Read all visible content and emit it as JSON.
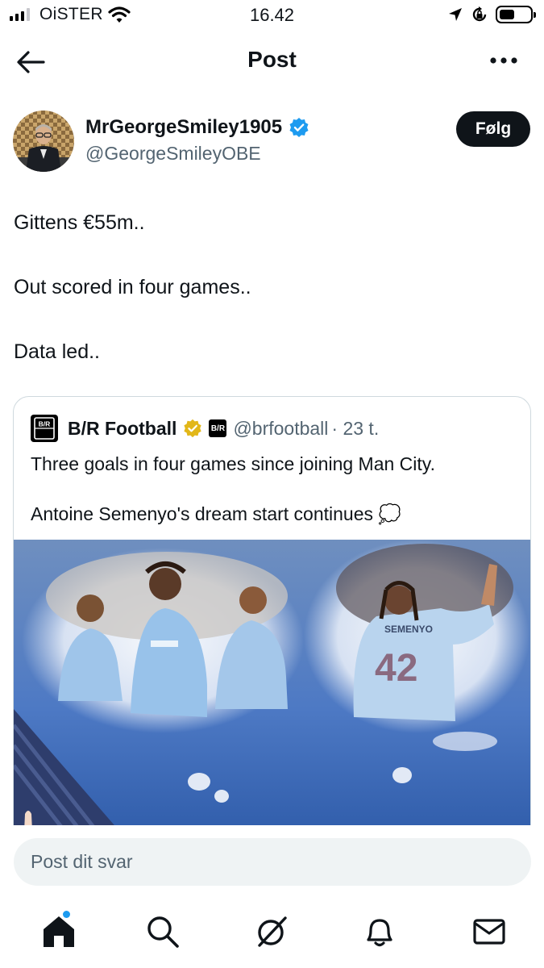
{
  "status_bar": {
    "carrier": "OiSTER",
    "time": "16.42",
    "icons": [
      "signal-icon",
      "wifi-icon",
      "location-arrow-icon",
      "rotation-lock-icon",
      "battery-icon"
    ]
  },
  "header": {
    "title": "Post",
    "back_icon": "arrow-left-icon",
    "more_icon": "more-dots-icon"
  },
  "author": {
    "name": "MrGeorgeSmiley1905",
    "handle": "@GeorgeSmileyOBE",
    "verified": true,
    "follow_label": "Følg"
  },
  "post": {
    "lines": [
      "Gittens €55m..",
      "Out scored in four games..",
      "Data led.."
    ]
  },
  "quote": {
    "logo_text": "B/R",
    "name": "B/R Football",
    "handle": "@brfootball",
    "time": "· 23 t.",
    "text_line1": "Three goals in four games since joining Man City.",
    "text_line2": "Antoine Semenyo's dream start continues",
    "emoji": "💭",
    "jersey_name": "SEMENYO",
    "jersey_number": "42"
  },
  "reply": {
    "placeholder": "Post dit svar"
  },
  "tabs": [
    {
      "name": "home",
      "icon": "home-icon"
    },
    {
      "name": "search",
      "icon": "search-icon"
    },
    {
      "name": "grok",
      "icon": "grok-icon"
    },
    {
      "name": "notifications",
      "icon": "bell-icon"
    },
    {
      "name": "messages",
      "icon": "mail-icon"
    }
  ],
  "colors": {
    "accent": "#1d9bf0",
    "text": "#0f1419",
    "secondary": "#536471",
    "verified_gold": "#e2b719"
  }
}
